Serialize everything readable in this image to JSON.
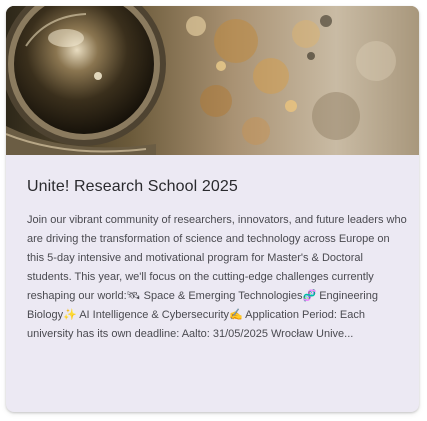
{
  "card": {
    "image_icon": "astronaut-helmet-photo",
    "title": "Unite! Research School 2025",
    "description": "Join our vibrant community of researchers, innovators, and future leaders who are driving the transformation of science and technology across Europe on this 5-day intensive and motivational program for Master's & Doctoral students. This year, we'll focus on the cutting-edge challenges currently reshaping our world:🛰 Space & Emerging Technologies🧬 Engineering Biology✨ AI Intelligence & Cybersecurity✍ Application Period: Each university has its own deadline: Aalto: 31/05/2025 Wrocław Unive..."
  },
  "colors": {
    "card_background": "#ece9f3",
    "title_text": "#2a2a2e",
    "body_text": "#4a4a50"
  }
}
